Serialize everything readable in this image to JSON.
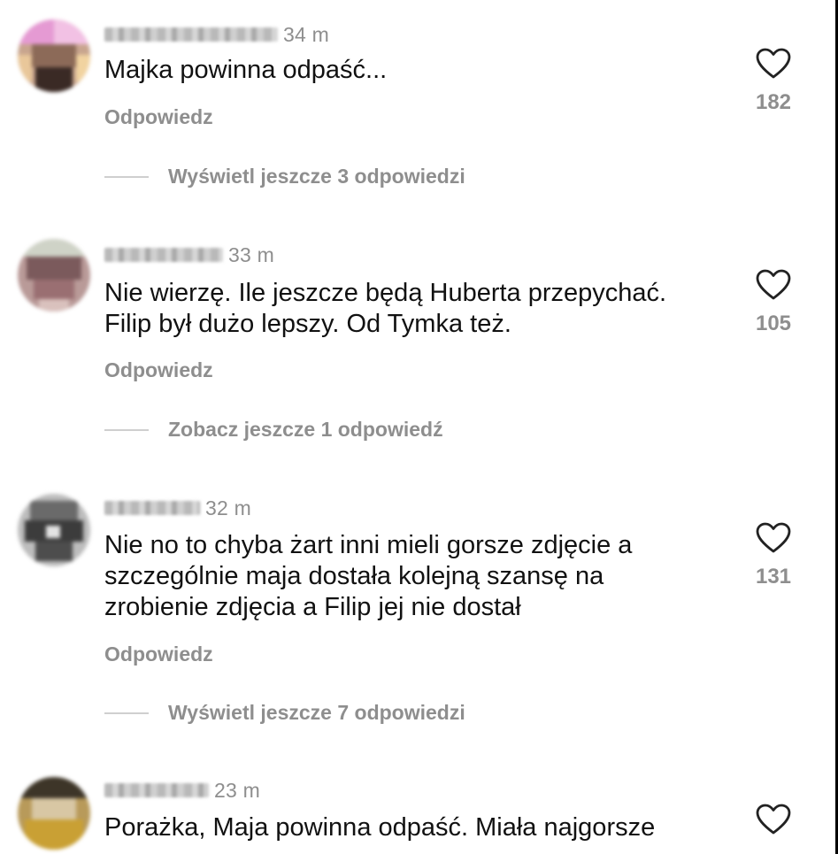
{
  "comments": [
    {
      "time": "34 m",
      "lines": [
        "Majka powinna odpaść..."
      ],
      "reply_label": "Odpowiedz",
      "likes": "182",
      "more_label": "Wyświetl jeszcze 3 odpowiedzi"
    },
    {
      "time": "33 m",
      "lines": [
        "Nie wierzę. Ile jeszcze będą Huberta przepychać.",
        "Filip był dużo lepszy. Od Tymka też."
      ],
      "reply_label": "Odpowiedz",
      "likes": "105",
      "more_label": "Zobacz jeszcze 1 odpowiedź"
    },
    {
      "time": "32 m",
      "lines": [
        "Nie no to chyba żart inni mieli gorsze zdjęcie a",
        "szczególnie maja dostała kolejną szansę na",
        "zrobienie zdjęcia a Filip jej nie dostał"
      ],
      "reply_label": "Odpowiedz",
      "likes": "131",
      "more_label": "Wyświetl jeszcze 7 odpowiedzi"
    },
    {
      "time": "23 m",
      "lines": [
        "Porażka, Maja powinna odpaść. Miała najgorsze"
      ]
    }
  ],
  "icons": {
    "like": "heart-outline-icon"
  },
  "colors": {
    "text": "#111111",
    "muted": "#8e8e8e",
    "divider": "#cfcfcf"
  }
}
